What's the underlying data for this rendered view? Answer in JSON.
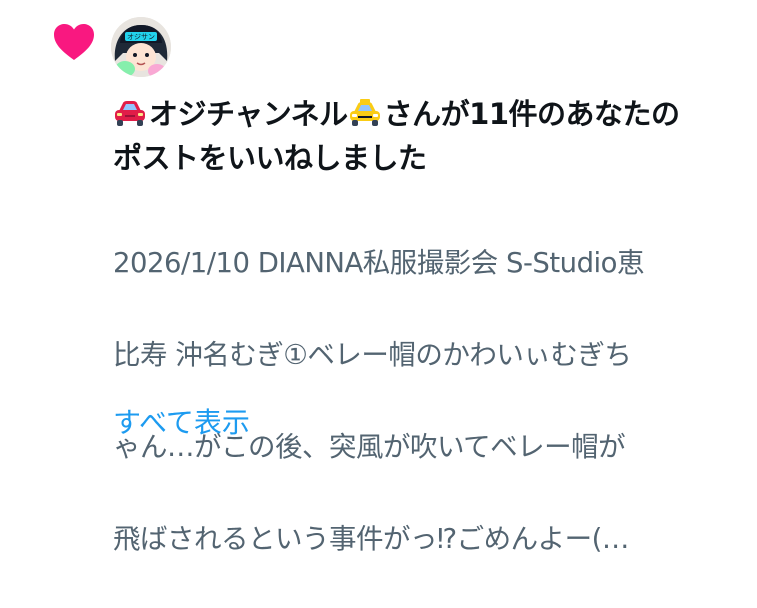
{
  "notification": {
    "line1_name": "オジチャンネル",
    "line1_suffix": "さんが11件のあなたの",
    "line2": "ポストをいいねしました"
  },
  "post_snippet": {
    "line1": "2026/1/10 DIANNA私服撮影会 S-Studio恵",
    "line2": "比寿 沖名むぎ①ベレー帽のかわいぃむぎち",
    "line3": "ゃん…がこの後、突風が吹いてベレー帽が",
    "line4": "飛ばされるという事件がっ⁉︎ごめんよー(…"
  },
  "show_all_label": "すべて表示",
  "avatar_text": "オジサン",
  "colors": {
    "heart": "#f91880",
    "text_primary": "#0f1419",
    "text_secondary": "#536471",
    "link": "#1d9bf0"
  },
  "icons": [
    "heart-icon",
    "red-car-emoji",
    "taxi-emoji",
    "avatar"
  ]
}
